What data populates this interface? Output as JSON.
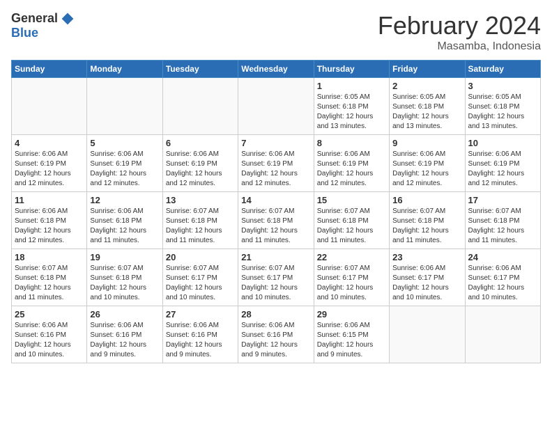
{
  "logo": {
    "general": "General",
    "blue": "Blue"
  },
  "title": {
    "month_year": "February 2024",
    "location": "Masamba, Indonesia"
  },
  "header_days": [
    "Sunday",
    "Monday",
    "Tuesday",
    "Wednesday",
    "Thursday",
    "Friday",
    "Saturday"
  ],
  "weeks": [
    [
      {
        "day": "",
        "info": ""
      },
      {
        "day": "",
        "info": ""
      },
      {
        "day": "",
        "info": ""
      },
      {
        "day": "",
        "info": ""
      },
      {
        "day": "1",
        "info": "Sunrise: 6:05 AM\nSunset: 6:18 PM\nDaylight: 12 hours\nand 13 minutes."
      },
      {
        "day": "2",
        "info": "Sunrise: 6:05 AM\nSunset: 6:18 PM\nDaylight: 12 hours\nand 13 minutes."
      },
      {
        "day": "3",
        "info": "Sunrise: 6:05 AM\nSunset: 6:18 PM\nDaylight: 12 hours\nand 13 minutes."
      }
    ],
    [
      {
        "day": "4",
        "info": "Sunrise: 6:06 AM\nSunset: 6:19 PM\nDaylight: 12 hours\nand 12 minutes."
      },
      {
        "day": "5",
        "info": "Sunrise: 6:06 AM\nSunset: 6:19 PM\nDaylight: 12 hours\nand 12 minutes."
      },
      {
        "day": "6",
        "info": "Sunrise: 6:06 AM\nSunset: 6:19 PM\nDaylight: 12 hours\nand 12 minutes."
      },
      {
        "day": "7",
        "info": "Sunrise: 6:06 AM\nSunset: 6:19 PM\nDaylight: 12 hours\nand 12 minutes."
      },
      {
        "day": "8",
        "info": "Sunrise: 6:06 AM\nSunset: 6:19 PM\nDaylight: 12 hours\nand 12 minutes."
      },
      {
        "day": "9",
        "info": "Sunrise: 6:06 AM\nSunset: 6:19 PM\nDaylight: 12 hours\nand 12 minutes."
      },
      {
        "day": "10",
        "info": "Sunrise: 6:06 AM\nSunset: 6:19 PM\nDaylight: 12 hours\nand 12 minutes."
      }
    ],
    [
      {
        "day": "11",
        "info": "Sunrise: 6:06 AM\nSunset: 6:18 PM\nDaylight: 12 hours\nand 12 minutes."
      },
      {
        "day": "12",
        "info": "Sunrise: 6:06 AM\nSunset: 6:18 PM\nDaylight: 12 hours\nand 11 minutes."
      },
      {
        "day": "13",
        "info": "Sunrise: 6:07 AM\nSunset: 6:18 PM\nDaylight: 12 hours\nand 11 minutes."
      },
      {
        "day": "14",
        "info": "Sunrise: 6:07 AM\nSunset: 6:18 PM\nDaylight: 12 hours\nand 11 minutes."
      },
      {
        "day": "15",
        "info": "Sunrise: 6:07 AM\nSunset: 6:18 PM\nDaylight: 12 hours\nand 11 minutes."
      },
      {
        "day": "16",
        "info": "Sunrise: 6:07 AM\nSunset: 6:18 PM\nDaylight: 12 hours\nand 11 minutes."
      },
      {
        "day": "17",
        "info": "Sunrise: 6:07 AM\nSunset: 6:18 PM\nDaylight: 12 hours\nand 11 minutes."
      }
    ],
    [
      {
        "day": "18",
        "info": "Sunrise: 6:07 AM\nSunset: 6:18 PM\nDaylight: 12 hours\nand 11 minutes."
      },
      {
        "day": "19",
        "info": "Sunrise: 6:07 AM\nSunset: 6:18 PM\nDaylight: 12 hours\nand 10 minutes."
      },
      {
        "day": "20",
        "info": "Sunrise: 6:07 AM\nSunset: 6:17 PM\nDaylight: 12 hours\nand 10 minutes."
      },
      {
        "day": "21",
        "info": "Sunrise: 6:07 AM\nSunset: 6:17 PM\nDaylight: 12 hours\nand 10 minutes."
      },
      {
        "day": "22",
        "info": "Sunrise: 6:07 AM\nSunset: 6:17 PM\nDaylight: 12 hours\nand 10 minutes."
      },
      {
        "day": "23",
        "info": "Sunrise: 6:06 AM\nSunset: 6:17 PM\nDaylight: 12 hours\nand 10 minutes."
      },
      {
        "day": "24",
        "info": "Sunrise: 6:06 AM\nSunset: 6:17 PM\nDaylight: 12 hours\nand 10 minutes."
      }
    ],
    [
      {
        "day": "25",
        "info": "Sunrise: 6:06 AM\nSunset: 6:16 PM\nDaylight: 12 hours\nand 10 minutes."
      },
      {
        "day": "26",
        "info": "Sunrise: 6:06 AM\nSunset: 6:16 PM\nDaylight: 12 hours\nand 9 minutes."
      },
      {
        "day": "27",
        "info": "Sunrise: 6:06 AM\nSunset: 6:16 PM\nDaylight: 12 hours\nand 9 minutes."
      },
      {
        "day": "28",
        "info": "Sunrise: 6:06 AM\nSunset: 6:16 PM\nDaylight: 12 hours\nand 9 minutes."
      },
      {
        "day": "29",
        "info": "Sunrise: 6:06 AM\nSunset: 6:15 PM\nDaylight: 12 hours\nand 9 minutes."
      },
      {
        "day": "",
        "info": ""
      },
      {
        "day": "",
        "info": ""
      }
    ]
  ]
}
